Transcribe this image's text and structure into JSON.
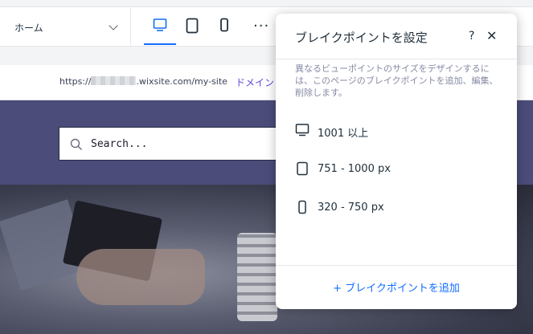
{
  "toolbar": {
    "page_select": {
      "value": "ホーム"
    },
    "breakpoint_buttons": [
      {
        "name": "desktop",
        "icon": "desktop-icon",
        "active": true
      },
      {
        "name": "tablet",
        "icon": "tablet-icon",
        "active": false
      },
      {
        "name": "mobile",
        "icon": "mobile-icon",
        "active": false
      }
    ],
    "more_label": "···",
    "accent_color": "#116dff"
  },
  "url_bar": {
    "prefix": "https://",
    "suffix": ".wixsite.com/my-site",
    "domain_link": "ドメイン"
  },
  "site": {
    "search_placeholder": "Search..."
  },
  "popup": {
    "title": "ブレイクポイントを設定",
    "help": "?",
    "close": "✕",
    "description": "異なるビューポイントのサイズをデザインするには、このページのブレイクポイントを追加、編集、削除します。",
    "breakpoints": [
      {
        "label": "1001 以上",
        "icon": "desktop-icon"
      },
      {
        "label": "751 - 1000 px",
        "icon": "tablet-icon"
      },
      {
        "label": "320 - 750 px",
        "icon": "mobile-icon"
      }
    ],
    "add_label": "+ ブレイクポイントを追加"
  }
}
